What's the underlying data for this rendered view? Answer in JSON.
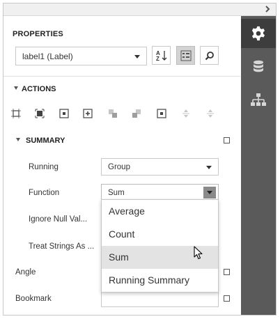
{
  "header": {
    "title": "PROPERTIES"
  },
  "selector": {
    "value": "label1 (Label)"
  },
  "toolbar": {
    "sort_icon": "sort-alpha-icon",
    "categorized_icon": "categorized-icon",
    "search_icon": "search-icon"
  },
  "actions": {
    "title": "ACTIONS",
    "icons": [
      "align-to-grid-icon",
      "size-to-grid-icon",
      "center-horizontally-icon",
      "center-vertically-icon",
      "bring-to-front-icon",
      "send-to-back-icon",
      "fit-bounds-icon",
      "anchor-vertical-icon",
      "anchor-horizontal-icon"
    ]
  },
  "summary": {
    "title": "SUMMARY",
    "running_label": "Running",
    "running_value": "Group",
    "function_label": "Function",
    "function_value": "Sum",
    "ignore_null_label": "Ignore Null Val...",
    "treat_strings_label": "Treat Strings As ..."
  },
  "properties": {
    "angle_label": "Angle",
    "bookmark_label": "Bookmark"
  },
  "dropdown": {
    "options": [
      "Average",
      "Count",
      "Sum",
      "Running Summary"
    ],
    "hovered": "Sum"
  },
  "sidebar": {
    "tabs": [
      "properties-gear-icon",
      "field-list-database-icon",
      "report-explorer-icon"
    ],
    "active": "properties-gear-icon"
  },
  "colors": {
    "sidebar_bg": "#5a5a5a",
    "sidebar_active": "#3d3d3d",
    "hover_item": "#e3e3e3"
  }
}
